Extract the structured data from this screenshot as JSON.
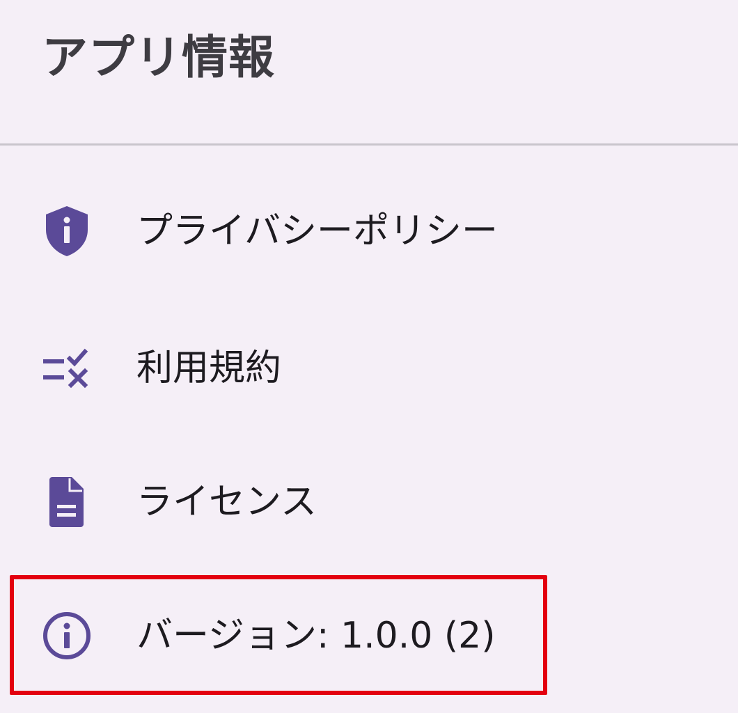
{
  "header": {
    "title": "アプリ情報"
  },
  "items": [
    {
      "label": "プライバシーポリシー",
      "icon": "shield-info-icon"
    },
    {
      "label": "利用規約",
      "icon": "terms-checklist-icon"
    },
    {
      "label": "ライセンス",
      "icon": "document-icon"
    },
    {
      "label": "バージョン: 1.0.0 (2)",
      "icon": "info-circle-icon"
    }
  ],
  "colors": {
    "background": "#f5eff7",
    "icon": "#5b4a98",
    "text": "#1d1b20",
    "title": "#3e3c42",
    "divider": "#c9c5cc",
    "highlight": "#e3000f"
  }
}
